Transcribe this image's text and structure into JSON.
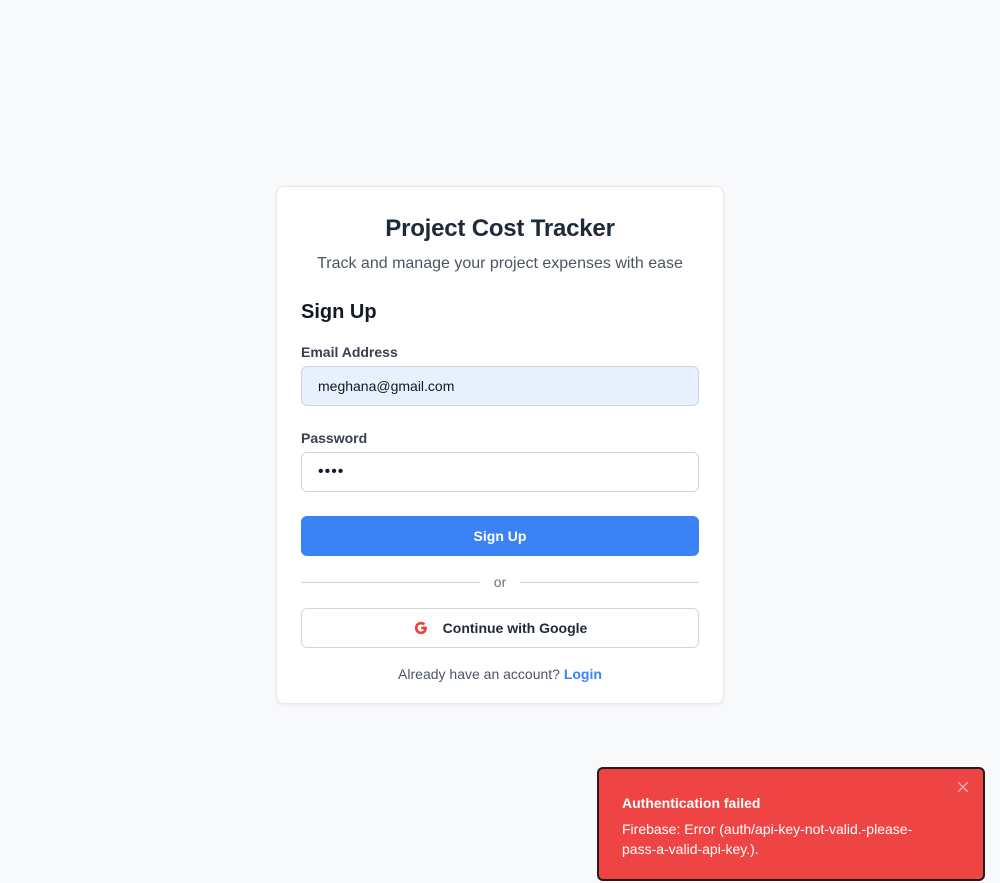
{
  "app": {
    "title": "Project Cost Tracker",
    "subtitle": "Track and manage your project expenses with ease"
  },
  "form": {
    "title": "Sign Up",
    "email": {
      "label": "Email Address",
      "value": "meghana@gmail.com",
      "placeholder": ""
    },
    "password": {
      "label": "Password",
      "value": "••••",
      "placeholder": ""
    },
    "submit_label": "Sign Up",
    "divider_text": "or",
    "google_label": "Continue with Google",
    "footer_text": "Already have an account?",
    "login_link": "Login"
  },
  "toast": {
    "title": "Authentication failed",
    "message": "Firebase: Error (auth/api-key-not-valid.-please-pass-a-valid-api-key.).",
    "close_icon": "close-icon"
  },
  "colors": {
    "primary": "#3b82f6",
    "error": "#ef4444",
    "background": "#f8f9fb",
    "autofill": "#e8f0fe"
  },
  "icons": {
    "google": "google-g-icon"
  }
}
